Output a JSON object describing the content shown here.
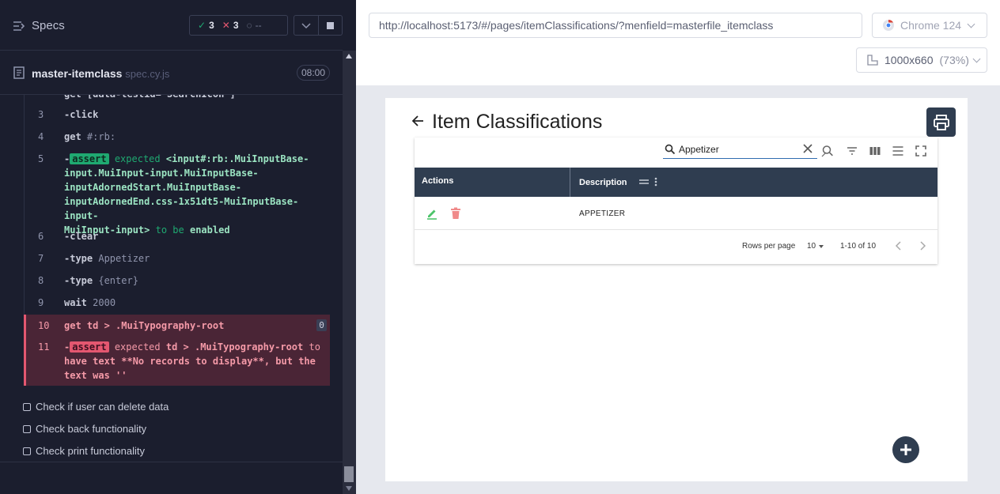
{
  "runner": {
    "title": "Specs",
    "passed": "3",
    "failed": "3",
    "pending": "--",
    "spec_name": "master-itemclass",
    "spec_ext": "spec.cy.js",
    "timer": "08:00"
  },
  "commands": {
    "c2_body": "get [data-testid=\"SearchIcon\"]",
    "c3_num": "3",
    "c3_body": "-click",
    "c4_num": "4",
    "c4_name": "get",
    "c4_arg": "#:rb:",
    "c5_num": "5",
    "c5_dash": "-",
    "c5_tag": "assert",
    "c5_word": "expected",
    "c5_line1": "<input#:rb:.MuiInputBase-",
    "c5_line2": "input.MuiInput-input.MuiInputBase-",
    "c5_line3": "inputAdornedStart.MuiInputBase-",
    "c5_line4": "inputAdornedEnd.css-1x51dt5-MuiInputBase-input-",
    "c5_line5a": "MuiInput-input>",
    "c5_line5b": "to be",
    "c5_line5c": "enabled",
    "c6_num": "6",
    "c6_body": "-clear",
    "c7_num": "7",
    "c7_name": "-type",
    "c7_arg": "Appetizer",
    "c8_num": "8",
    "c8_name": "-type",
    "c8_arg": "{enter}",
    "c9_num": "9",
    "c9_name": "wait",
    "c9_arg": "2000",
    "c10_num": "10",
    "c10_name": "get",
    "c10_arg": "td > .MuiTypography-root",
    "c10_badge": "0",
    "c11_num": "11",
    "c11_dash": "-",
    "c11_tag": "assert",
    "c11_word": "expected",
    "c11_sel": "td > .MuiTypography-root",
    "c11_to": "to",
    "c11_line2": "have text **No records to display**, but the",
    "c11_line3": "text was ''"
  },
  "tests": [
    "Check if user can delete data",
    "Check back functionality",
    "Check print functionality"
  ],
  "browser": {
    "url": "http://localhost:5173/#/pages/itemClassifications/?menfield=masterfile_itemclass",
    "browser_name": "Chrome 124",
    "viewport": "1000x660",
    "zoom": "(73%)"
  },
  "app": {
    "title": "Item Classifications",
    "search_value": "Appetizer",
    "columns": [
      "Actions",
      "Description"
    ],
    "rows": [
      {
        "description": "APPETIZER"
      }
    ],
    "rows_per_page_label": "Rows per page",
    "rows_per_page": "10",
    "range": "1-10 of 10"
  },
  "colors": {
    "header_dark": "#2f3d50",
    "pass": "#1fa971",
    "fail": "#e45770",
    "edit": "#4cc46a",
    "delete": "#f08a8a"
  }
}
